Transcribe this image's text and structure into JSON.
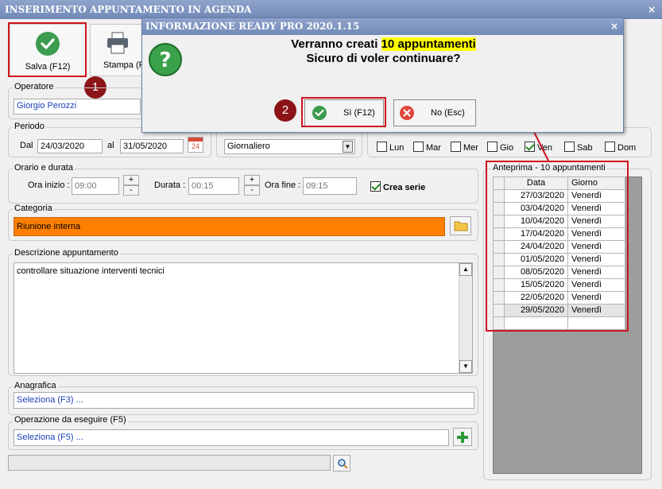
{
  "window": {
    "title": "INSERIMENTO APPUNTAMENTO IN AGENDA",
    "close": "×"
  },
  "toolbar": {
    "save_label": "Salva (F12)",
    "print_label": "Stampa (F"
  },
  "badges": {
    "one": "1",
    "two": "2"
  },
  "operatore": {
    "label": "Operatore",
    "value": "Giorgio Perozzi"
  },
  "periodo": {
    "label": "Periodo",
    "dal_label": "Dal",
    "dal_value": "24/03/2020",
    "al_label": "al",
    "al_value": "31/05/2020",
    "cal_icon_text": "24"
  },
  "frequenza": {
    "value": "Giornaliero"
  },
  "days": [
    {
      "label": "Lun",
      "checked": false
    },
    {
      "label": "Mar",
      "checked": false
    },
    {
      "label": "Mer",
      "checked": false
    },
    {
      "label": "Gio",
      "checked": false
    },
    {
      "label": "Ven",
      "checked": true
    },
    {
      "label": "Sab",
      "checked": false
    },
    {
      "label": "Dom",
      "checked": false
    }
  ],
  "orario": {
    "label": "Orario e durata",
    "inizio_label": "Ora inizio :",
    "inizio_value": "09:00",
    "durata_label": "Durata :",
    "durata_value": "00:15",
    "fine_label": "Ora fine :",
    "fine_value": "09:15",
    "crea_serie_label": "Crea serie",
    "crea_serie_checked": true,
    "plus": "+",
    "minus": "-"
  },
  "categoria": {
    "label": "Categoria",
    "value": "Riunione interna",
    "color": "#ff8000"
  },
  "descrizione": {
    "label": "Descrizione appuntamento",
    "value": "controllare situazione interventi tecnici"
  },
  "anagrafica": {
    "label": "Anagrafica",
    "value": "Seleziona (F3) ..."
  },
  "operazione": {
    "label": "Operazione da eseguire (F5)",
    "value": "Seleziona (F5) ..."
  },
  "anteprima": {
    "label": "Anteprima - 10 appuntamenti",
    "headers": [
      "Data",
      "Giorno"
    ],
    "rows": [
      [
        "27/03/2020",
        "Venerdì"
      ],
      [
        "03/04/2020",
        "Venerdì"
      ],
      [
        "10/04/2020",
        "Venerdì"
      ],
      [
        "17/04/2020",
        "Venerdì"
      ],
      [
        "24/04/2020",
        "Venerdì"
      ],
      [
        "01/05/2020",
        "Venerdì"
      ],
      [
        "08/05/2020",
        "Venerdì"
      ],
      [
        "15/05/2020",
        "Venerdì"
      ],
      [
        "22/05/2020",
        "Venerdì"
      ],
      [
        "29/05/2020",
        "Venerdì"
      ]
    ]
  },
  "dialog": {
    "title": "INFORMAZIONE READY PRO 2020.1.15",
    "close": "×",
    "msg_prefix": "Verranno creati ",
    "msg_highlight": "10 appuntamenti",
    "msg_line2": "Sicuro di voler continuare?",
    "yes_label": "Sì (F12)",
    "no_label": "No (Esc)"
  },
  "colors": {
    "accent_red": "#d0141c",
    "badge": "#8b1419",
    "titlebar": "#7f96c2"
  }
}
